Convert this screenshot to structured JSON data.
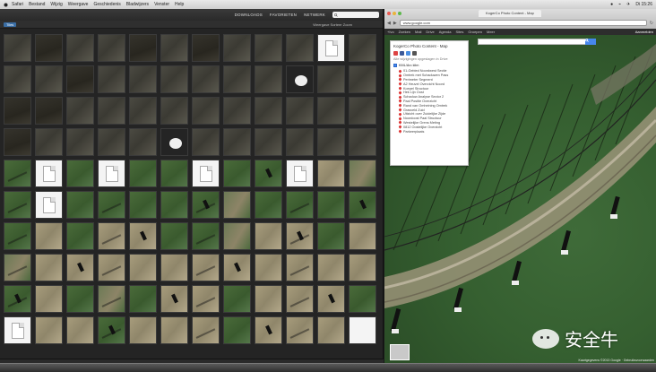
{
  "menubar": {
    "items": [
      "Safari",
      "Bestand",
      "Wijzig",
      "Weergave",
      "Geschiedenis",
      "Bladwijzers",
      "Venster",
      "Help"
    ],
    "right": [
      "●",
      "⌁",
      "✈",
      "Di 15:26"
    ]
  },
  "file_browser": {
    "toolbar_buttons": [
      "DOWNLOADS",
      "FAVORIETEN",
      "NETWERK"
    ],
    "search_placeholder": "",
    "path_crumb": "Tiles",
    "view_options": "Weergave  Sorteer  Zoom",
    "tiles": [
      "roof",
      "dark",
      "roof",
      "roof",
      "dark",
      "roof",
      "dark",
      "roof",
      "roof",
      "roof",
      "doc",
      "roof",
      "roof",
      "roof",
      "dark",
      "roof",
      "roof",
      "roof",
      "roof",
      "roof",
      "roof",
      "dome",
      "roof",
      "roof",
      "dark",
      "dark",
      "roof",
      "roof",
      "roof",
      "roof",
      "roof",
      "roof",
      "roof",
      "roof",
      "roof",
      "roof",
      "dark",
      "roof",
      "roof",
      "roof",
      "roof",
      "dome",
      "roof",
      "roof",
      "roof",
      "roof",
      "roof",
      "roof",
      "grass",
      "doc",
      "grass",
      "doc",
      "grass",
      "grass",
      "doc",
      "grass",
      "grass",
      "doc",
      "dirt",
      "mix",
      "grass",
      "doc",
      "grass",
      "grass",
      "grass",
      "grass",
      "grass",
      "mix",
      "grass",
      "grass",
      "grass",
      "grass",
      "grass",
      "dirt",
      "grass",
      "dirt",
      "dirt",
      "grass",
      "grass",
      "mix",
      "dirt",
      "dirt",
      "grass",
      "dirt",
      "mix",
      "dirt",
      "dirt",
      "dirt",
      "dirt",
      "dirt",
      "dirt",
      "dirt",
      "dirt",
      "dirt",
      "dirt",
      "dirt",
      "grass",
      "dirt",
      "grass",
      "mix",
      "grass",
      "dirt",
      "dirt",
      "grass",
      "dirt",
      "dirt",
      "dirt",
      "grass",
      "doc",
      "dirt",
      "dirt",
      "grass",
      "dirt",
      "dirt",
      "dirt",
      "grass",
      "dirt",
      "dirt",
      "dirt",
      "blank"
    ]
  },
  "browser": {
    "tab_title": "KogerCo Photo Content - Map",
    "url": "www.google.com",
    "google_bar": [
      "+Ivo",
      "Zoeken",
      "Mail",
      "Drive",
      "Agenda",
      "Sites",
      "Groepen",
      "Meer"
    ],
    "user": "Aanmelden"
  },
  "map": {
    "panel": {
      "title": "KogerCo Photo Content - Map",
      "meta": "Alle wijzigingen opgeslagen in Drive",
      "layer_name": "KML/Arc klim",
      "items": [
        "01-Gebied Noordwest Sectie",
        "Omtrek met Schaduwen Pass",
        "Perimeter Segment",
        "A2 Heuvel Overzicht Noord",
        "Koepel Structuur",
        "Hek Lijn Oost",
        "Schaduw Analyse Sector 2",
        "Paal Positie Overzicht",
        "Rand van Omheining Omtrek",
        "Grasveld Zuid",
        "Uitzicht over Zuidelijke Zijde",
        "Noordoost Paal Structuur",
        "Westelijke Grens Meting",
        "0812 Oostelijke Overzicht",
        "Parkeerplaats"
      ]
    },
    "footer": "Kaartgegevens ©2013 Google · Gebruiksvoorwaarden",
    "watermark_text": "安全牛"
  },
  "colors": {
    "accent": "#4787ed",
    "pin": "#dd3333",
    "grass": "#3a5a2e",
    "dirt": "#a79c7c"
  }
}
